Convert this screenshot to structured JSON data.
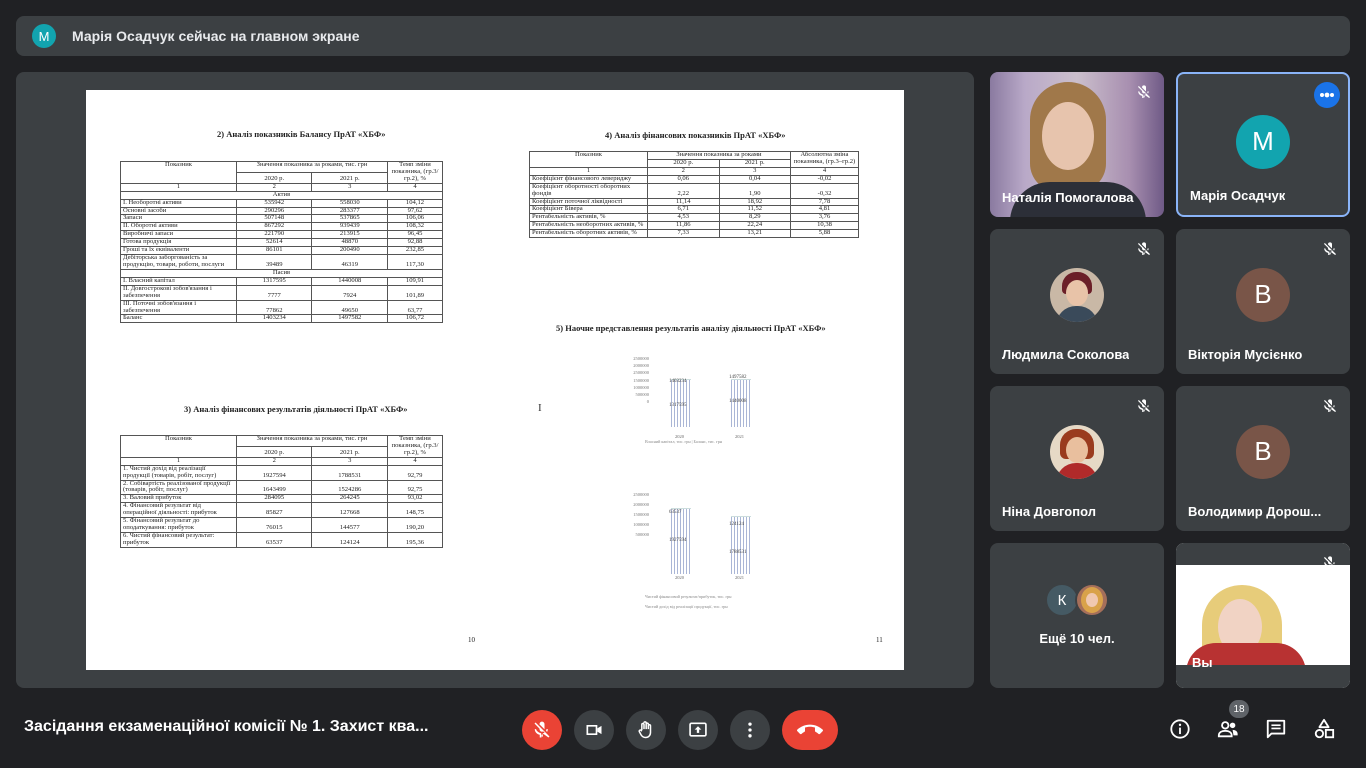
{
  "banner": {
    "avatar_letter": "М",
    "text": "Марія Осадчук сейчас на главном экране",
    "avatar_color": "#12a4af"
  },
  "doc": {
    "left": {
      "title2": "2) Аналіз показників Балансу ПрАТ «ХБФ»",
      "t1_head": {
        "c1": "Показник",
        "c2": "Значення показника за роками, тис. грн",
        "c4": "Темп зміни показника, (гр.3/гр.2), %",
        "y1": "2020 р.",
        "y2": "2021 р.",
        "n1": "1",
        "n2": "2",
        "n3": "3",
        "n4": "4"
      },
      "t1_section1": "Актив",
      "t1_rows1": [
        [
          "І. Необоротні активи",
          "535942",
          "558030",
          "104,12"
        ],
        [
          "Основні засоби",
          "290296",
          "283377",
          "97,62"
        ],
        [
          "Запаси",
          "507148",
          "537865",
          "106,06"
        ],
        [
          "ІІ. Оборотні активи",
          "867292",
          "939439",
          "108,32"
        ],
        [
          "Виробничі запаси",
          "221790",
          "213915",
          "96,45"
        ],
        [
          "Готова продукція",
          "52614",
          "48870",
          "92,88"
        ],
        [
          "Гроші та їх еквіваленти",
          "86101",
          "200490",
          "232,85"
        ],
        [
          "Дебіторська заборгованість за продукцію, товари, роботи, послуги",
          "39489",
          "46319",
          "117,30"
        ]
      ],
      "t1_section2": "Пасив",
      "t1_rows2": [
        [
          "І. Власний капітал",
          "1317595",
          "1440008",
          "109,91"
        ],
        [
          "ІІ. Довгострокові зобов'язання і забезпечення",
          "7777",
          "7924",
          "101,89"
        ],
        [
          "ІІІ. Поточні зобов'язання і забезпечення",
          "77862",
          "49650",
          "63,77"
        ],
        [
          "Баланс",
          "1403234",
          "1497582",
          "106,72"
        ]
      ],
      "title3": "3) Аналіз фінансових результатів діяльності ПрАТ «ХБФ»",
      "t2_head": {
        "c1": "Показник",
        "c2": "Значення показника за роками, тис. грн",
        "c4": "Темп зміни показника, (гр.3/гр.2), %",
        "y1": "2020 р.",
        "y2": "2021 р.",
        "n1": "1",
        "n2": "2",
        "n3": "3",
        "n4": "4"
      },
      "t2_rows": [
        [
          "1. Чистий дохід від реалізації продукції (товарів, робіт, послуг)",
          "1927594",
          "1788531",
          "92,79"
        ],
        [
          "2. Собівартість реалізованої продукції (товарів, робіт, послуг)",
          "1643499",
          "1524286",
          "92,75"
        ],
        [
          "3. Валовий прибуток",
          "284095",
          "264245",
          "93,02"
        ],
        [
          "4. Фінансовий результат від операційної діяльності: прибуток",
          "85827",
          "127668",
          "148,75"
        ],
        [
          "5. Фінансовий результат до оподаткування: прибуток",
          "76015",
          "144577",
          "190,20"
        ],
        [
          "6. Чистий фінансовий результат: прибуток",
          "63537",
          "124124",
          "195,36"
        ]
      ],
      "page": "10"
    },
    "right": {
      "title4": "4) Аналіз фінансових показників ПрАТ «ХБФ»",
      "t3_head": {
        "c1": "Показник",
        "c2": "Значення показника за роками",
        "c4": "Абсолютна зміна показника, (гр.3–гр.2)",
        "y1": "2020 р.",
        "y2": "2021 р.",
        "n1": "1",
        "n2": "2",
        "n3": "3",
        "n4": "4"
      },
      "t3_rows": [
        [
          "Коефіцієнт фінансового левериджу",
          "0,06",
          "0,04",
          "-0,02"
        ],
        [
          "Коефіцієнт оборотності оборотних фондів",
          "2,22",
          "1,90",
          "-0,32"
        ],
        [
          "Коефіцієнт поточної ліквідності",
          "11,14",
          "18,92",
          "7,78"
        ],
        [
          "Коефіцієнт Бівера",
          "6,71",
          "11,52",
          "4,81"
        ],
        [
          "Рентабельність активів, %",
          "4,53",
          "8,29",
          "3,76"
        ],
        [
          "Рентабельність необоротних активів, %",
          "11,86",
          "22,24",
          "10,38"
        ],
        [
          "Рентабельність оборотних активів, %",
          "7,33",
          "13,21",
          "5,88"
        ]
      ],
      "title5": "5) Наочне представлення результатів аналізу діяльності ПрАТ «ХБФ»",
      "chart1": {
        "yticks": [
          "2500000",
          "2000000",
          "1500000",
          "1000000",
          "500000",
          "0"
        ],
        "yticks_top": [
          "2500000",
          "2000000",
          "2500000",
          "1500000",
          "1000000",
          "500000",
          "0"
        ],
        "bar_labels": [
          "1403234",
          "1497582",
          "1317595",
          "1440008"
        ],
        "x": [
          "2020",
          "2021"
        ],
        "legend": "Власний капітал, тис. грн   |   Баланс, тис. грн"
      },
      "chart2": {
        "yticks": [
          "2500000",
          "2000000",
          "1500000",
          "1000000",
          "500000"
        ],
        "bar_labels": [
          "63537",
          "1927594",
          "124124",
          "1788531"
        ],
        "x": [
          "2020",
          "2021"
        ],
        "legend1": "Чистий фінансовий результат/прибуток, тис. грн",
        "legend2": "Чистий дохід від реалізації продукції, тис. грн"
      },
      "page": "11"
    }
  },
  "participants": [
    {
      "name": "Наталія Помогалова",
      "kind": "video"
    },
    {
      "name": "Марія Осадчук",
      "kind": "avatar",
      "letter": "М",
      "color": "#12a4af"
    },
    {
      "name": "Людмила Соколова",
      "kind": "photo"
    },
    {
      "name": "Вікторія Мусієнко",
      "kind": "avatar",
      "letter": "В",
      "color": "#795548"
    },
    {
      "name": "Ніна Довгопол",
      "kind": "photo"
    },
    {
      "name": "Володимир Дорош...",
      "kind": "avatar",
      "letter": "В",
      "color": "#795548"
    },
    {
      "name": "Ещё 10 чел.",
      "kind": "more",
      "letter": "К"
    },
    {
      "name": "Вы",
      "kind": "video"
    }
  ],
  "bottom": {
    "meeting_title": "Засідання екзаменаційної комісії № 1. Захист ква...",
    "participants_count": "18",
    "colors": {
      "danger": "#ea4335",
      "control_bg": "#3c4043"
    }
  }
}
